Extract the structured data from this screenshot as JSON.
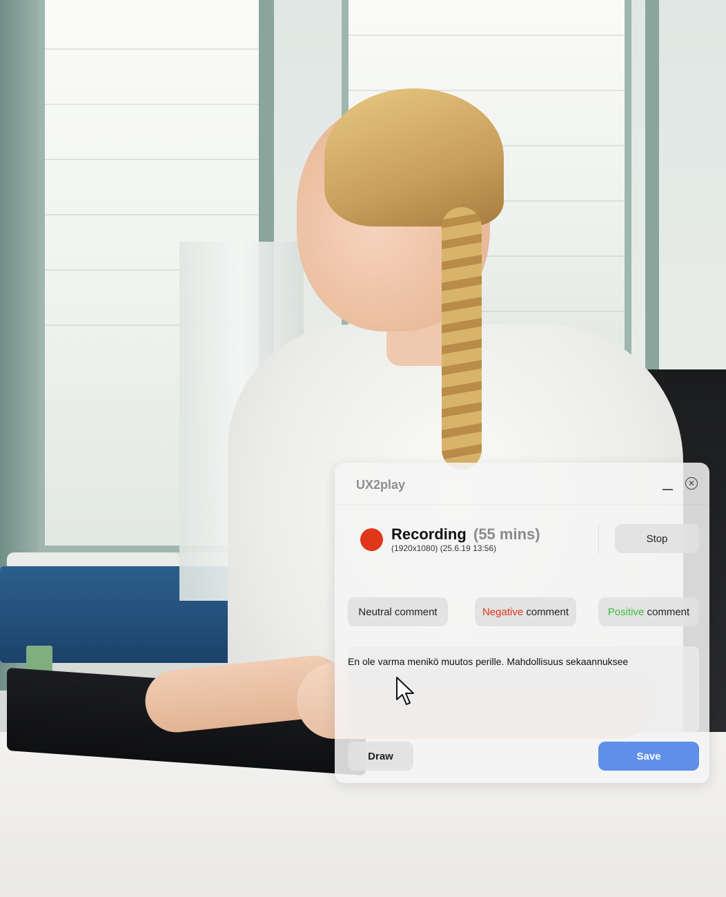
{
  "window": {
    "title": "UX2play",
    "minimize_icon": "minimize-icon",
    "close_icon": "close-circle-icon"
  },
  "recording": {
    "status_label": "Recording",
    "duration": "(55 mins)",
    "meta": "(1920x1080) (25.6.19 13:56)",
    "indicator_color": "#e0371b",
    "stop_label": "Stop"
  },
  "comment_buttons": {
    "neutral": {
      "prefix": "Neutral",
      "suffix": " comment"
    },
    "negative": {
      "prefix": "Negative",
      "suffix": " comment",
      "color": "#e0371b"
    },
    "positive": {
      "prefix": "Positive",
      "suffix": " comment",
      "color": "#3bbf3b"
    }
  },
  "comment_field": {
    "value": "En ole varma menikö muutos perille. Mahdollisuus sekaannuksee"
  },
  "footer": {
    "draw_label": "Draw",
    "save_label": "Save",
    "save_color": "#5f8fe8"
  },
  "cursor_icon": "arrow-pointer-icon"
}
